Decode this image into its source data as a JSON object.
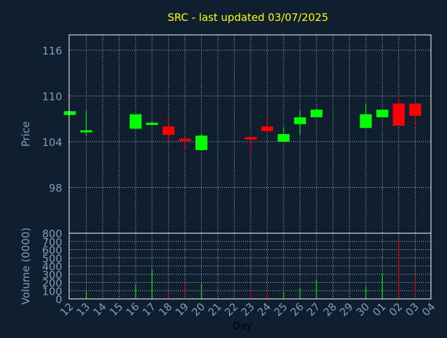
{
  "chart_data": [
    {
      "type": "candlestick",
      "title": "SRC - last updated 03/07/2025",
      "ylabel": "Price",
      "xlabel": "",
      "ylim": [
        92,
        118
      ],
      "yticks": [
        98,
        104,
        110,
        116
      ],
      "grid": true,
      "categories": [
        "12",
        "13",
        "14",
        "15",
        "16",
        "17",
        "18",
        "19",
        "20",
        "21",
        "22",
        "23",
        "24",
        "25",
        "26",
        "27",
        "28",
        "29",
        "30",
        "01",
        "02",
        "03",
        "04"
      ],
      "series": [
        {
          "candles": [
            {
              "x": "12",
              "open": 107.5,
              "close": 108.0,
              "high": 108.0,
              "low": 107.5,
              "dir": "up"
            },
            {
              "x": "13",
              "open": 105.3,
              "close": 105.5,
              "high": 108.0,
              "low": 104.8,
              "dir": "up"
            },
            {
              "x": "16",
              "open": 105.7,
              "close": 107.6,
              "high": 107.6,
              "low": 105.7,
              "dir": "up"
            },
            {
              "x": "17",
              "open": 106.2,
              "close": 106.5,
              "high": 106.7,
              "low": 106.2,
              "dir": "up"
            },
            {
              "x": "18",
              "open": 106.0,
              "close": 104.9,
              "high": 107.2,
              "low": 104.0,
              "dir": "down"
            },
            {
              "x": "19",
              "open": 104.4,
              "close": 104.1,
              "high": 104.8,
              "low": 102.8,
              "dir": "down"
            },
            {
              "x": "20",
              "open": 102.9,
              "close": 104.8,
              "high": 105.0,
              "low": 102.9,
              "dir": "up"
            },
            {
              "x": "23",
              "open": 104.6,
              "close": 104.3,
              "high": 104.8,
              "low": 102.4,
              "dir": "down"
            },
            {
              "x": "24",
              "open": 106.0,
              "close": 105.4,
              "high": 107.4,
              "low": 105.0,
              "dir": "down"
            },
            {
              "x": "25",
              "open": 104.0,
              "close": 105.0,
              "high": 105.9,
              "low": 104.0,
              "dir": "up"
            },
            {
              "x": "26",
              "open": 106.3,
              "close": 107.2,
              "high": 108.0,
              "low": 104.9,
              "dir": "up"
            },
            {
              "x": "27",
              "open": 107.2,
              "close": 108.2,
              "high": 108.4,
              "low": 107.2,
              "dir": "up"
            },
            {
              "x": "30",
              "open": 105.8,
              "close": 107.6,
              "high": 109.0,
              "low": 105.8,
              "dir": "up"
            },
            {
              "x": "01",
              "open": 107.2,
              "close": 108.2,
              "high": 108.2,
              "low": 107.2,
              "dir": "up"
            },
            {
              "x": "02",
              "open": 109.0,
              "close": 106.1,
              "high": 110.1,
              "low": 106.1,
              "dir": "down"
            },
            {
              "x": "03",
              "open": 109.0,
              "close": 107.4,
              "high": 109.0,
              "low": 106.1,
              "dir": "down"
            }
          ]
        }
      ],
      "colors": {
        "up": "#00ff00",
        "down": "#ff0000",
        "axis_label": "#7f9fbf",
        "title": "#ffff00",
        "background": "#0f1f30"
      }
    },
    {
      "type": "bar",
      "ylabel": "Volume (0000)",
      "xlabel": "Day",
      "ylim": [
        0,
        800
      ],
      "yticks": [
        0,
        100,
        200,
        300,
        400,
        500,
        600,
        700,
        800
      ],
      "categories": [
        "12",
        "13",
        "14",
        "15",
        "16",
        "17",
        "18",
        "19",
        "20",
        "21",
        "22",
        "23",
        "24",
        "25",
        "26",
        "27",
        "28",
        "29",
        "30",
        "01",
        "02",
        "03",
        "04"
      ],
      "series": [
        {
          "bars": [
            {
              "x": "13",
              "value": 100,
              "dir": "up"
            },
            {
              "x": "16",
              "value": 180,
              "dir": "up"
            },
            {
              "x": "17",
              "value": 360,
              "dir": "up"
            },
            {
              "x": "18",
              "value": 80,
              "dir": "down"
            },
            {
              "x": "19",
              "value": 200,
              "dir": "down"
            },
            {
              "x": "20",
              "value": 190,
              "dir": "up"
            },
            {
              "x": "23",
              "value": 110,
              "dir": "down"
            },
            {
              "x": "24",
              "value": 110,
              "dir": "down"
            },
            {
              "x": "25",
              "value": 80,
              "dir": "up"
            },
            {
              "x": "26",
              "value": 130,
              "dir": "up"
            },
            {
              "x": "27",
              "value": 240,
              "dir": "up"
            },
            {
              "x": "30",
              "value": 150,
              "dir": "up"
            },
            {
              "x": "01",
              "value": 300,
              "dir": "up"
            },
            {
              "x": "02",
              "value": 710,
              "dir": "down"
            },
            {
              "x": "03",
              "value": 290,
              "dir": "down"
            }
          ]
        }
      ]
    }
  ]
}
